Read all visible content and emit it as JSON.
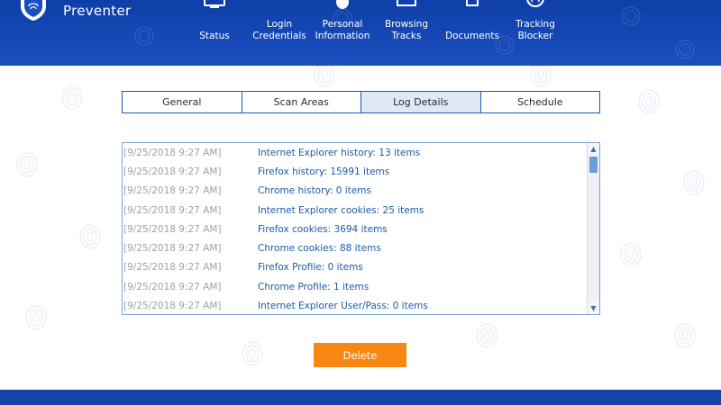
{
  "app": {
    "brand": "Preventer",
    "colors": {
      "header": "#1a4fc0",
      "accent": "#f68712",
      "text_blue": "#1c5aa8",
      "time_gray": "#9aa3ad"
    }
  },
  "nav": {
    "items": [
      {
        "label": "Status",
        "icon": "monitor-icon"
      },
      {
        "label": "Login\nCredentials",
        "icon": "login-icon"
      },
      {
        "label": "Personal\nInformation",
        "icon": "person-icon"
      },
      {
        "label": "Browsing\nTracks",
        "icon": "browser-icon"
      },
      {
        "label": "Documents",
        "icon": "document-icon"
      },
      {
        "label": "Tracking\nBlocker",
        "icon": "fingerprint-icon"
      }
    ]
  },
  "tabs": [
    {
      "label": "General",
      "active": false
    },
    {
      "label": "Scan Areas",
      "active": false
    },
    {
      "label": "Log Details",
      "active": true
    },
    {
      "label": "Schedule",
      "active": false
    }
  ],
  "log": {
    "rows": [
      {
        "time": "[9/25/2018 9:27 AM]",
        "text": "Internet Explorer history: 13 items"
      },
      {
        "time": "[9/25/2018 9:27 AM]",
        "text": "Firefox history: 15991 items"
      },
      {
        "time": "[9/25/2018 9:27 AM]",
        "text": "Chrome history: 0 items"
      },
      {
        "time": "[9/25/2018 9:27 AM]",
        "text": "Internet Explorer cookies: 25 items"
      },
      {
        "time": "[9/25/2018 9:27 AM]",
        "text": "Firefox cookies: 3694 items"
      },
      {
        "time": "[9/25/2018 9:27 AM]",
        "text": "Chrome cookies: 88 items"
      },
      {
        "time": "[9/25/2018 9:27 AM]",
        "text": "Firefox Profile: 0 items"
      },
      {
        "time": "[9/25/2018 9:27 AM]",
        "text": "Chrome Profile: 1 items"
      },
      {
        "time": "[9/25/2018 9:27 AM]",
        "text": "Internet Explorer User/Pass: 0 items"
      }
    ]
  },
  "actions": {
    "delete_label": "Delete"
  }
}
